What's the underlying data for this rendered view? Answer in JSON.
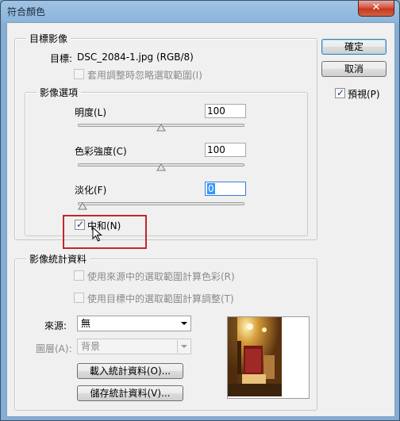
{
  "window": {
    "title": "符合顏色",
    "close_glyph": "✕"
  },
  "target_image": {
    "group_title": "目標影像",
    "target_label": "目標:",
    "target_value": "DSC_2084-1.jpg (RGB/8)",
    "ignore_selection_label": "套用調整時忽略選取範圍(I)",
    "ignore_selection_checked": false
  },
  "image_options": {
    "group_title": "影像選項",
    "luminance": {
      "label": "明度(L)",
      "value": "100",
      "slider_fraction": 0.5
    },
    "color_intensity": {
      "label": "色彩強度(C)",
      "value": "100",
      "slider_fraction": 0.5
    },
    "fade": {
      "label": "淡化(F)",
      "value": "0",
      "slider_fraction": 0.0
    },
    "neutralize": {
      "label": "中和(N)",
      "checked": true
    }
  },
  "buttons": {
    "ok": "確定",
    "cancel": "取消"
  },
  "preview": {
    "label": "預視(P)",
    "checked": true
  },
  "image_statistics": {
    "group_title": "影像統計資料",
    "use_source_selection_label": "使用來源中的選取範圍計算色彩(R)",
    "use_target_selection_label": "使用目標中的選取範圍計算調整(T)",
    "source_label": "來源:",
    "source_value": "無",
    "layer_label": "圖層(A):",
    "layer_value": "背景",
    "load_button": "載入統計資料(O)...",
    "save_button": "儲存統計資料(V)..."
  },
  "colors": {
    "highlight_border": "#c0272d",
    "checkmark": "#1a3f8a",
    "selected_text_bg": "#3399ff"
  }
}
